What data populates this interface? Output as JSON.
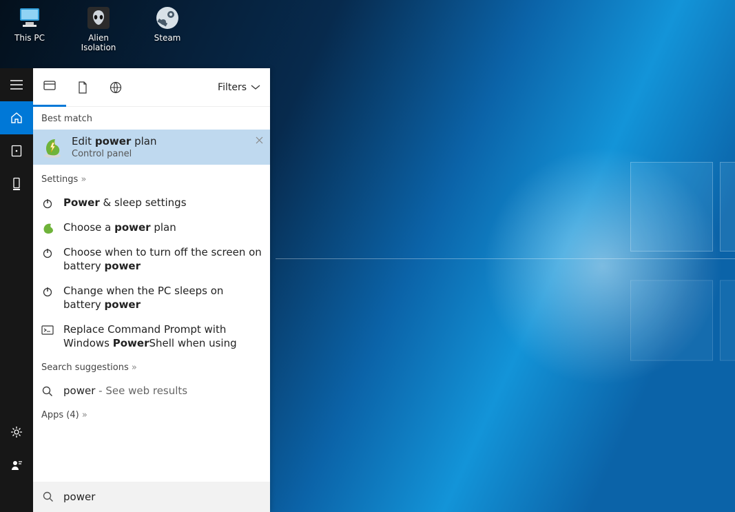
{
  "desktop_icons": [
    {
      "label": "This PC",
      "kind": "pc"
    },
    {
      "label": "Alien Isolation",
      "kind": "alien"
    },
    {
      "label": "Steam",
      "kind": "steam"
    }
  ],
  "panel": {
    "filters_label": "Filters",
    "sections": {
      "best_match_hdr": "Best match",
      "settings_hdr": "Settings",
      "search_sugg_hdr": "Search suggestions",
      "apps_hdr": "Apps (4)"
    },
    "best_match": {
      "title_pre": "Edit ",
      "title_bold": "power",
      "title_post": " plan",
      "subtitle": "Control panel"
    },
    "settings_items": [
      {
        "icon": "power",
        "pre": "",
        "bold": "Power",
        "post": " & sleep settings"
      },
      {
        "icon": "plan",
        "pre": "Choose a ",
        "bold": "power",
        "post": " plan"
      },
      {
        "icon": "power",
        "pre": "Choose when to turn off the screen on battery ",
        "bold": "power",
        "post": ""
      },
      {
        "icon": "power",
        "pre": "Change when the PC sleeps on battery ",
        "bold": "power",
        "post": ""
      },
      {
        "icon": "cmd",
        "pre": "Replace Command Prompt with Windows ",
        "bold": "Power",
        "post": "Shell when using"
      }
    ],
    "web": {
      "term": "power",
      "suffix": " - See web results"
    }
  },
  "search_value": "power"
}
